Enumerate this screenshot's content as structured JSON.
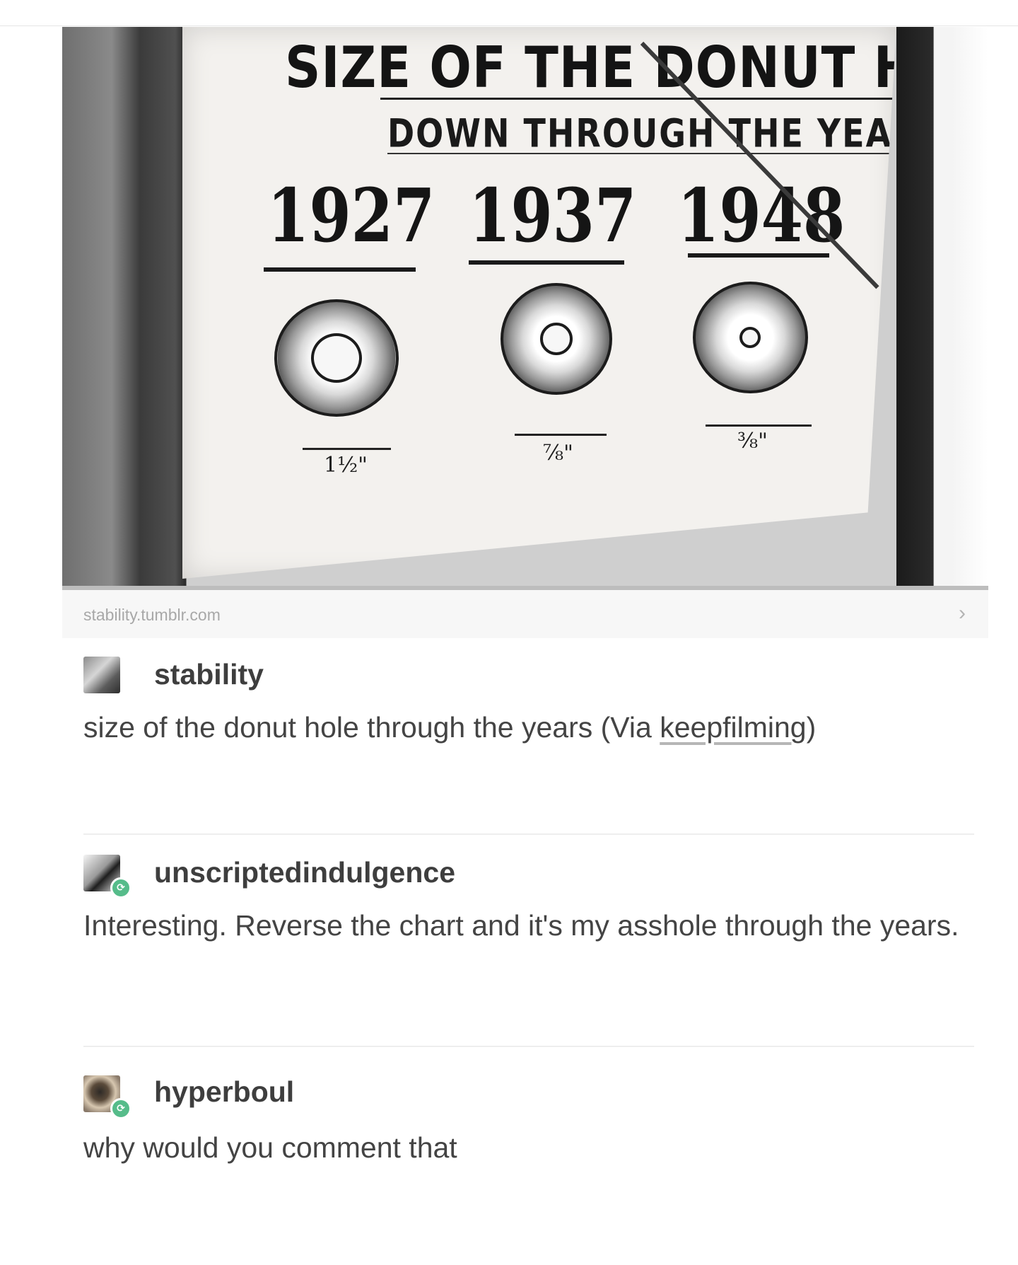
{
  "photo": {
    "title": "SIZE OF THE DONUT HOLE",
    "subtitle": "DOWN THROUGH THE YEARS",
    "years": [
      "1927",
      "1937",
      "1948"
    ],
    "sizes": [
      "1½\"",
      "⅞\"",
      "⅜\""
    ]
  },
  "source": {
    "link_text": "stability.tumblr.com",
    "chevron_icon": "chevron-right-icon"
  },
  "posts": [
    {
      "username": "stability",
      "text": "size of the donut hole through the years (Via ",
      "link_text": "keepfilming",
      "text_after": ")",
      "reblog_badge": false
    },
    {
      "username": "unscriptedindulgence",
      "text": "Interesting. Reverse the chart and it's my asshole through the years.",
      "reblog_badge": true
    },
    {
      "username": "hyperboul",
      "text": "why would you comment that",
      "reblog_badge": true
    }
  ],
  "colors": {
    "reblog_badge": "#56bc8a",
    "source_text": "#a8a8a8",
    "body_text": "#444444"
  }
}
